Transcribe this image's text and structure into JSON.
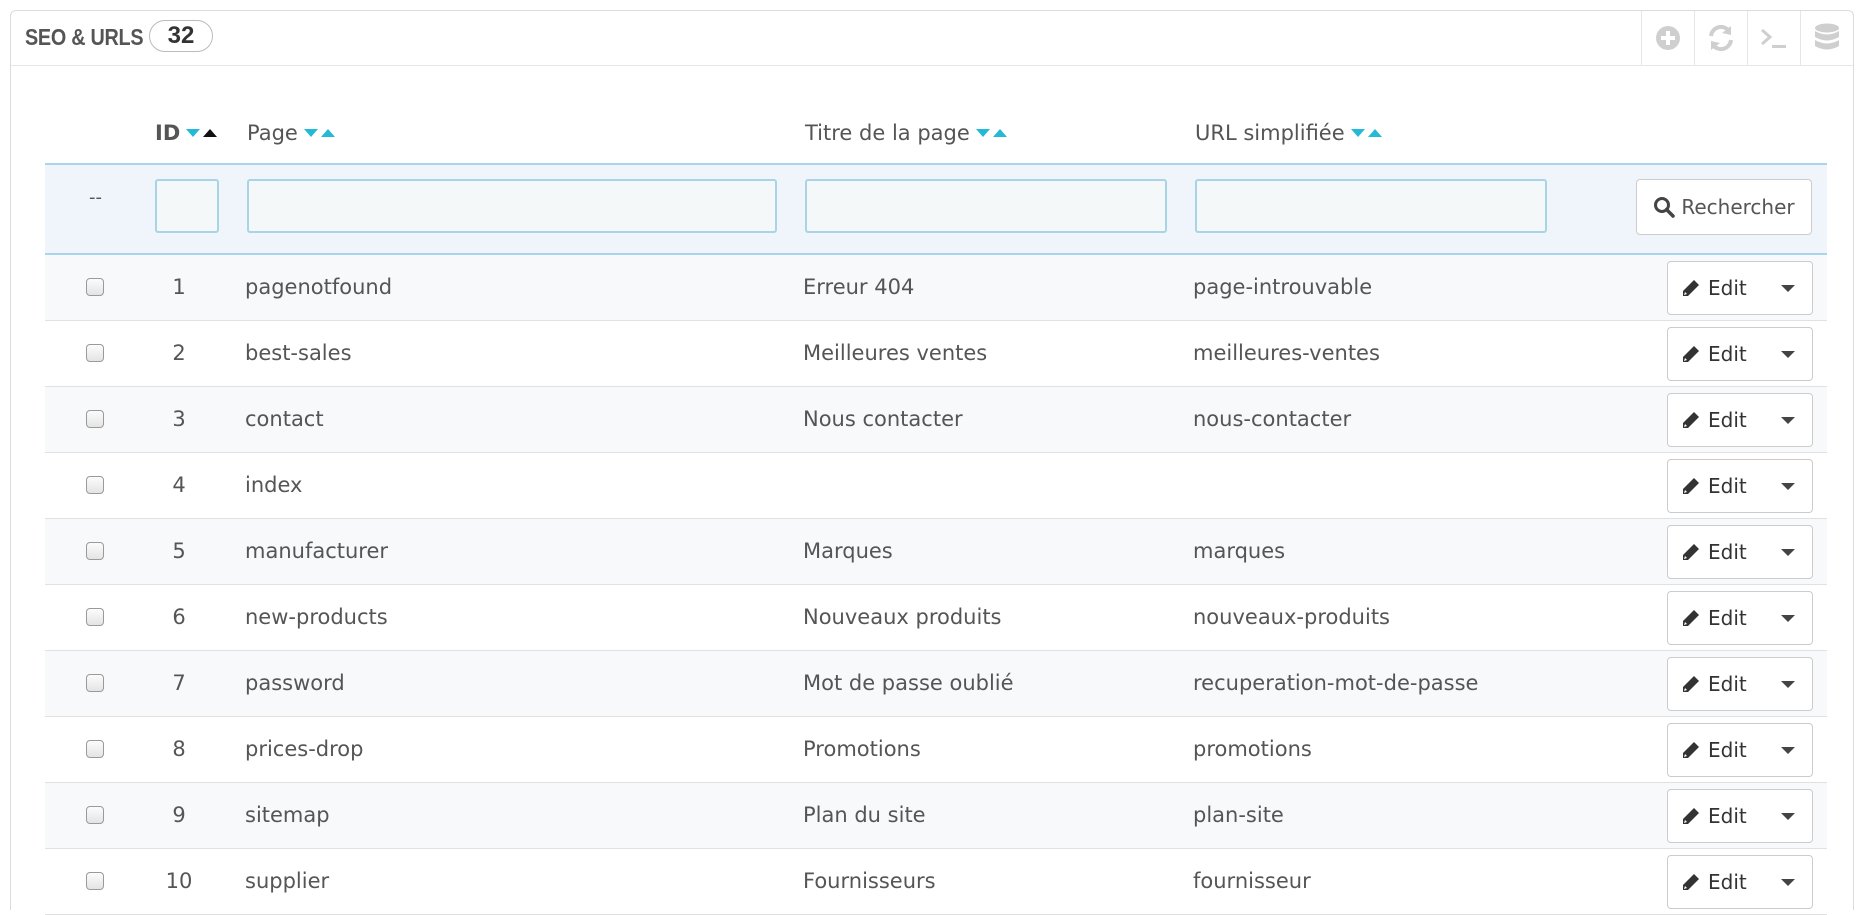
{
  "panel": {
    "title": "SEO & URLS",
    "count": "32",
    "toolbar": [
      {
        "icon": "plus-circle-icon"
      },
      {
        "icon": "refresh-icon"
      },
      {
        "icon": "terminal-icon"
      },
      {
        "icon": "database-icon"
      }
    ]
  },
  "table": {
    "columns": {
      "id": "ID",
      "page": "Page",
      "title": "Titre de la page",
      "url": "URL simplifiée"
    },
    "sort": {
      "column": "id",
      "direction": "asc"
    },
    "filters": {
      "dash": "--",
      "id": "",
      "page": "",
      "title": "",
      "url": "",
      "search_label": "Rechercher"
    },
    "rows": [
      {
        "id": "1",
        "page": "pagenotfound",
        "title": "Erreur 404",
        "url": "page-introuvable"
      },
      {
        "id": "2",
        "page": "best-sales",
        "title": "Meilleures ventes",
        "url": "meilleures-ventes"
      },
      {
        "id": "3",
        "page": "contact",
        "title": "Nous contacter",
        "url": "nous-contacter"
      },
      {
        "id": "4",
        "page": "index",
        "title": "",
        "url": ""
      },
      {
        "id": "5",
        "page": "manufacturer",
        "title": "Marques",
        "url": "marques"
      },
      {
        "id": "6",
        "page": "new-products",
        "title": "Nouveaux produits",
        "url": "nouveaux-produits"
      },
      {
        "id": "7",
        "page": "password",
        "title": "Mot de passe oublié",
        "url": "recuperation-mot-de-passe"
      },
      {
        "id": "8",
        "page": "prices-drop",
        "title": "Promotions",
        "url": "promotions"
      },
      {
        "id": "9",
        "page": "sitemap",
        "title": "Plan du site",
        "url": "plan-site"
      },
      {
        "id": "10",
        "page": "supplier",
        "title": "Fournisseurs",
        "url": "fournisseur"
      }
    ],
    "row_action_label": "Edit"
  },
  "colors": {
    "accent": "#25b9d7",
    "filter_bg": "#eff5fa",
    "filter_border": "#a9d5ea"
  }
}
